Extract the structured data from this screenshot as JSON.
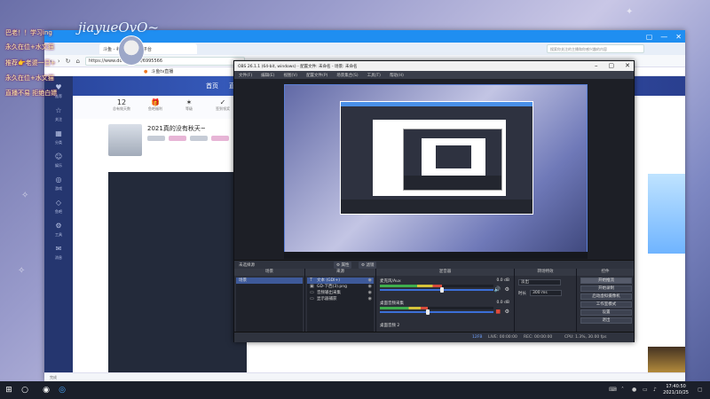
{
  "overlay": {
    "name": "jiayueOvO~",
    "lines": [
      "巴老！！学习ing",
      "永久在位+水文猫",
      "推荐👉老婆一日+",
      "永久在位+水文猫",
      "直播不易 拒绝白嫖"
    ]
  },
  "browser": {
    "tab_title": "斗鱼 - 每个人的直播平台",
    "url": "https://www.douyu.com/6995566",
    "search_placeholder": "搜索你关注的主播和你感兴趣的内容",
    "bookmark": "斗鱼tv直播",
    "window_controls": [
      "▢",
      "—",
      "✕"
    ]
  },
  "douyu": {
    "nav_tabs": [
      "首页",
      "直播"
    ],
    "stats": [
      {
        "value": "12",
        "label": "总有效天数"
      },
      {
        "value": "🎁",
        "label": "鱼吧福利"
      },
      {
        "value": "✶",
        "label": "等级"
      },
      {
        "value": "✓",
        "label": "签到领奖"
      }
    ],
    "room_title": "2021真的没有秋天~",
    "left_nav": [
      "推荐",
      "关注",
      "分类",
      "娱乐",
      "游戏",
      "鱼吧",
      "工具",
      "消息"
    ],
    "bottom_text": "完成"
  },
  "obs": {
    "title": "OBS 26.1.1 (64-bit, windows) - 配置文件: 未命名 - 场景: 未命名",
    "menu": [
      "文件(F)",
      "编辑(E)",
      "视图(V)",
      "配置文件(P)",
      "场景集合(S)",
      "工具(T)",
      "帮助(H)"
    ],
    "ctl_bar_label": "未选择源",
    "ctl_bar_buttons": [
      "⚙ 属性",
      "⚙ 滤镜"
    ],
    "docks": {
      "scenes": "场景",
      "sources": "来源",
      "mixer": "混音器",
      "transitions": "转场特效",
      "controls": "控件"
    },
    "scenes": [
      "场景"
    ],
    "sources": [
      {
        "icon": "T",
        "name": "文本 (GDI+)"
      },
      {
        "icon": "▣",
        "name": "GD-下西(3).png"
      },
      {
        "icon": "▭",
        "name": "音频输出采集"
      },
      {
        "icon": "▭",
        "name": "显示器捕获"
      }
    ],
    "mixer": [
      {
        "name": "麦克风/Aux",
        "db": "0.0 dB",
        "level": 0.55
      },
      {
        "name": "桌面音频采集",
        "db": "0.0 dB",
        "level": 0.42
      }
    ],
    "mixer_extra": "桌面音频 2",
    "transitions": {
      "type": "淡出",
      "duration_label": "时长",
      "duration_value": "300 ms"
    },
    "controls": [
      "开始推流",
      "开始录制",
      "启动虚拟摄像机",
      "工作室模式",
      "设置",
      "退出"
    ],
    "status": {
      "live": "LIVE: 00:00:00",
      "rec": "REC: 00:00:00",
      "cpu": "CPU: 1.3%, 30.00 fps",
      "frames": "12FB"
    }
  },
  "taskbar": {
    "time": "17:40:50",
    "date": "2021/10/25"
  }
}
